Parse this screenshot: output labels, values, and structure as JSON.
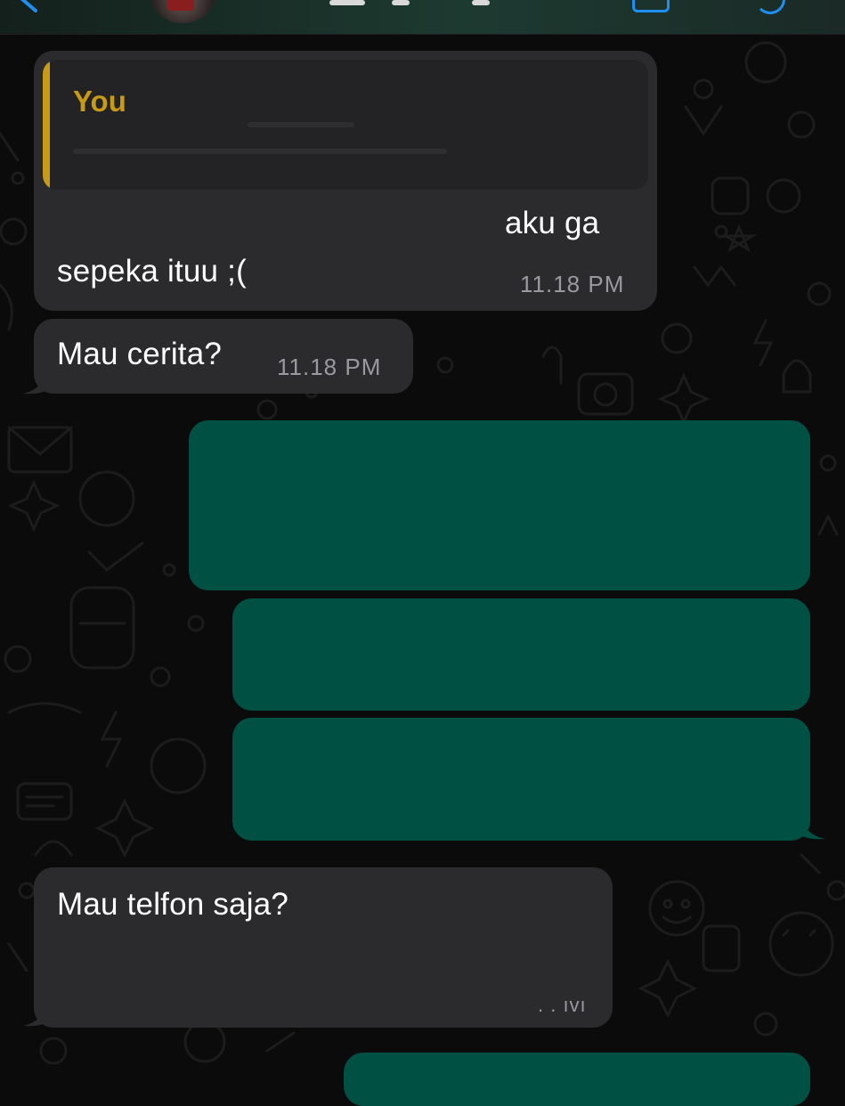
{
  "header": {
    "back_icon": "chevron-left-icon",
    "video_icon": "video-call-icon",
    "call_icon": "phone-icon",
    "accent_color": "#1f8ef1"
  },
  "messages": [
    {
      "direction": "incoming",
      "reply": {
        "author": "You"
      },
      "text_line1": "aku ga",
      "text_line2": "sepeka ituu ;(",
      "time": "11.18 PM"
    },
    {
      "direction": "incoming",
      "text": "Mau cerita?",
      "time": "11.18 PM"
    },
    {
      "direction": "outgoing",
      "redacted": true
    },
    {
      "direction": "outgoing",
      "redacted": true
    },
    {
      "direction": "outgoing",
      "redacted": true
    },
    {
      "direction": "incoming",
      "text": "Mau telfon saja?",
      "time_partial": ". . ıvı"
    },
    {
      "direction": "outgoing",
      "redacted": true
    }
  ],
  "colors": {
    "incoming_bubble": "#2b2b2d",
    "outgoing_bubble": "#005044",
    "reply_accent": "#c99a16",
    "background": "#0b0b0b"
  }
}
